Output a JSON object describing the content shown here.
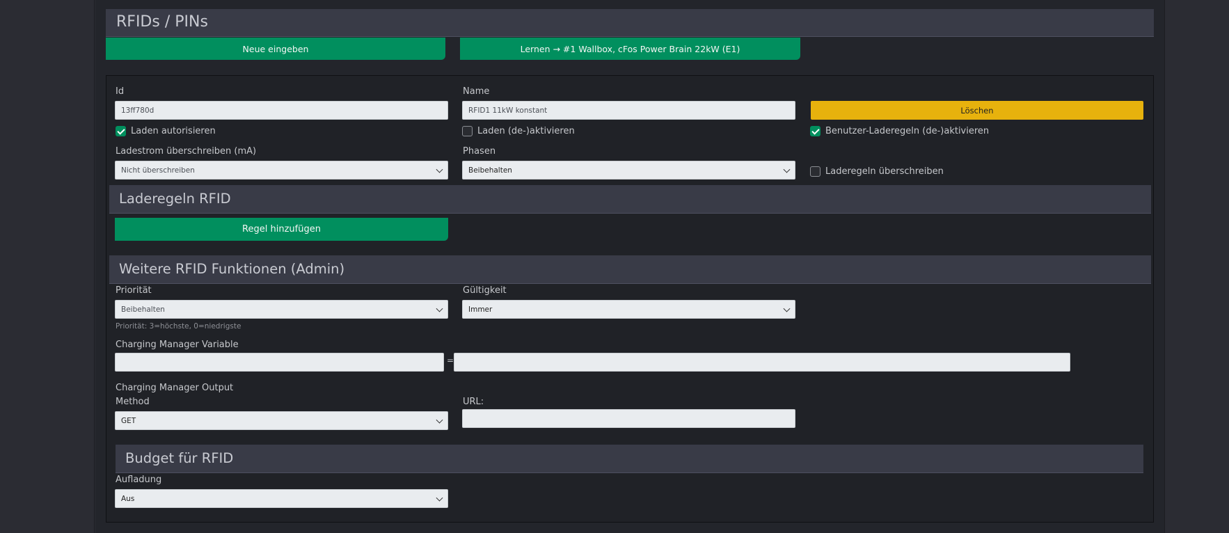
{
  "page": {
    "title": "RFIDs / PINs"
  },
  "toolbar": {
    "new_label": "Neue eingeben",
    "learn_label": "Lernen → #1 Wallbox, cFos Power Brain 22kW (E1)"
  },
  "rfid": {
    "id_label": "Id",
    "id_value": "13ff780d",
    "name_label": "Name",
    "name_value": "RFID1 11kW konstant",
    "delete_label": "Löschen",
    "checkboxes": {
      "authorize": {
        "label": "Laden autorisieren",
        "checked": true
      },
      "activate": {
        "label": "Laden (de-)aktivieren",
        "checked": false
      },
      "user_rules": {
        "label": "Benutzer-Laderegeln (de-)aktivieren",
        "checked": true
      },
      "override_rules": {
        "label": "Laderegeln überschreiben",
        "checked": false
      }
    },
    "current_label": "Ladestrom überschreiben (mA)",
    "current_value": "Nicht überschreiben",
    "phases_label": "Phasen",
    "phases_value": "Beibehalten"
  },
  "rules": {
    "title": "Laderegeln RFID",
    "add_label": "Regel hinzufügen"
  },
  "admin": {
    "title": "Weitere RFID Funktionen (Admin)",
    "priority_label": "Priorität",
    "priority_value": "Beibehalten",
    "priority_hint": "Priorität: 3=höchste, 0=niedrigste",
    "validity_label": "Gültigkeit",
    "validity_value": "Immer",
    "cm_variable_label": "Charging Manager Variable",
    "cm_variable_name": "",
    "equals": "=",
    "cm_variable_value": "",
    "cm_output_label": "Charging Manager Output",
    "method_label": "Method",
    "method_value": "GET",
    "url_label": "URL:",
    "url_value": ""
  },
  "budget": {
    "title": "Budget für RFID",
    "recharge_label": "Aufladung",
    "recharge_value": "Aus"
  }
}
